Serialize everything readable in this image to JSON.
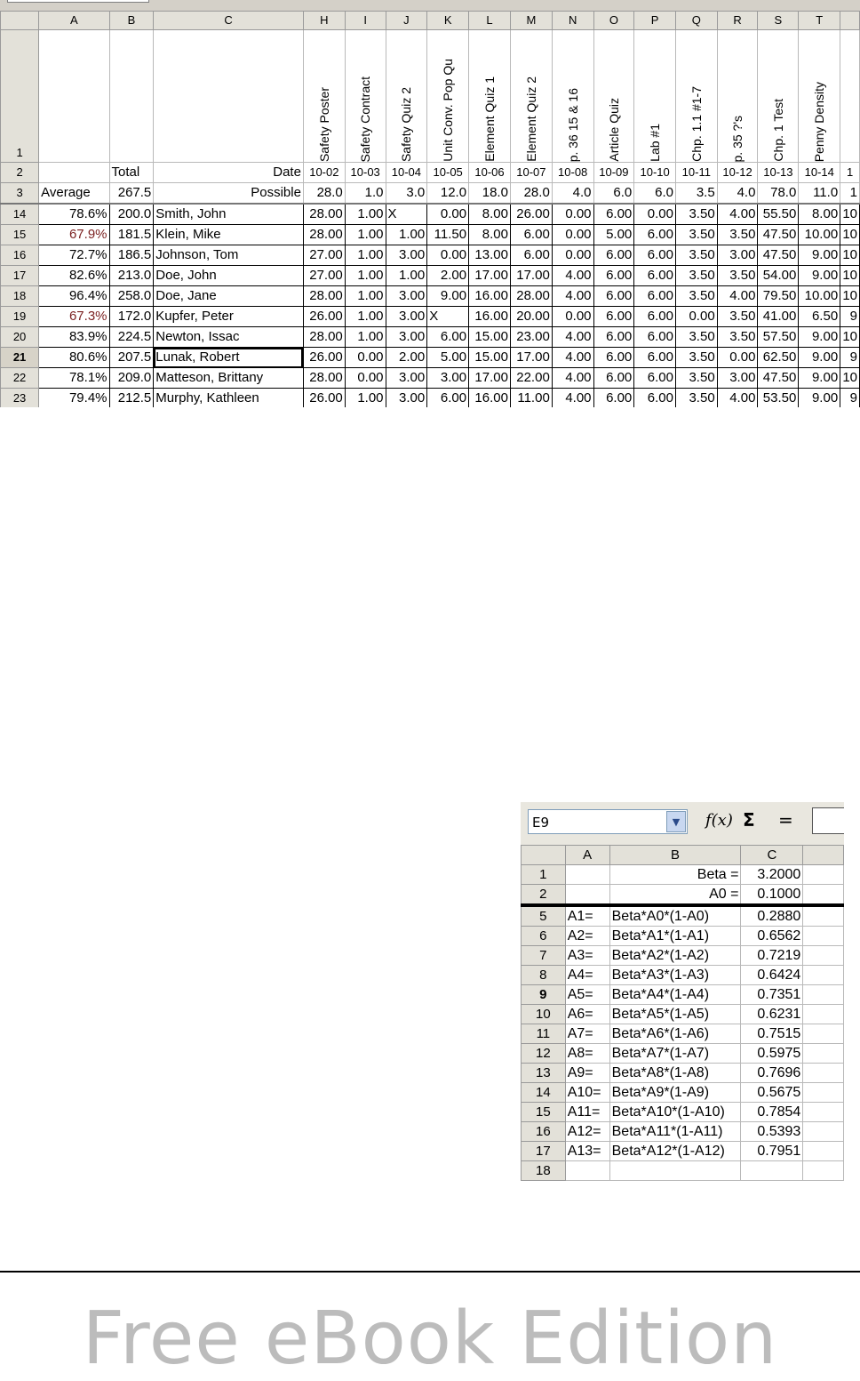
{
  "grades_sheet": {
    "columns": [
      "A",
      "B",
      "C",
      "H",
      "I",
      "J",
      "K",
      "L",
      "M",
      "N",
      "O",
      "P",
      "Q",
      "R",
      "S",
      "T",
      ""
    ],
    "assignments": [
      "Safety Poster",
      "Safety Contract",
      "Safety Quiz 2",
      "Unit Conv. Pop Qu",
      "Element Quiz 1",
      "Element Quiz 2",
      "p. 36 15 & 16",
      "Article Quiz",
      "Lab #1",
      "Chp. 1.1 #1-7",
      "p. 35 ?'s",
      "Chp. 1 Test",
      "Penny Density",
      ""
    ],
    "row2": {
      "num": "2",
      "a": "",
      "b": "Total",
      "c": "Date",
      "dates": [
        "10-02",
        "10-03",
        "10-04",
        "10-05",
        "10-06",
        "10-07",
        "10-08",
        "10-09",
        "10-10",
        "10-11",
        "10-12",
        "10-13",
        "10-14",
        "1"
      ]
    },
    "row3": {
      "num": "3",
      "a": "Average",
      "b": "267.5",
      "c": "Possible",
      "values": [
        "28.0",
        "1.0",
        "3.0",
        "12.0",
        "18.0",
        "28.0",
        "4.0",
        "6.0",
        "6.0",
        "3.5",
        "4.0",
        "78.0",
        "11.0",
        "1"
      ]
    },
    "row1_num": "1",
    "students": [
      {
        "row": "14",
        "pct": "78.6%",
        "total": "200.0",
        "name": "Smith, John",
        "scores": [
          "28.00",
          "1.00",
          "X",
          "0.00",
          "8.00",
          "26.00",
          "0.00",
          "6.00",
          "0.00",
          "3.50",
          "4.00",
          "55.50",
          "8.00",
          "10"
        ]
      },
      {
        "row": "15",
        "pct": "67.9%",
        "total": "181.5",
        "name": "Klein, Mike",
        "scores": [
          "28.00",
          "1.00",
          "1.00",
          "11.50",
          "8.00",
          "6.00",
          "0.00",
          "5.00",
          "6.00",
          "3.50",
          "3.50",
          "47.50",
          "10.00",
          "10"
        ]
      },
      {
        "row": "16",
        "pct": "72.7%",
        "total": "186.5",
        "name": "Johnson, Tom",
        "scores": [
          "27.00",
          "1.00",
          "3.00",
          "0.00",
          "13.00",
          "6.00",
          "0.00",
          "6.00",
          "6.00",
          "3.50",
          "3.00",
          "47.50",
          "9.00",
          "10"
        ]
      },
      {
        "row": "17",
        "pct": "82.6%",
        "total": "213.0",
        "name": "Doe, John",
        "scores": [
          "27.00",
          "1.00",
          "1.00",
          "2.00",
          "17.00",
          "17.00",
          "4.00",
          "6.00",
          "6.00",
          "3.50",
          "3.50",
          "54.00",
          "9.00",
          "10"
        ]
      },
      {
        "row": "18",
        "pct": "96.4%",
        "total": "258.0",
        "name": "Doe, Jane",
        "scores": [
          "28.00",
          "1.00",
          "3.00",
          "9.00",
          "16.00",
          "28.00",
          "4.00",
          "6.00",
          "6.00",
          "3.50",
          "4.00",
          "79.50",
          "10.00",
          "10"
        ]
      },
      {
        "row": "19",
        "pct": "67.3%",
        "total": "172.0",
        "name": "Kupfer, Peter",
        "scores": [
          "26.00",
          "1.00",
          "3.00",
          "X",
          "16.00",
          "20.00",
          "0.00",
          "6.00",
          "6.00",
          "0.00",
          "3.50",
          "41.00",
          "6.50",
          "9"
        ]
      },
      {
        "row": "20",
        "pct": "83.9%",
        "total": "224.5",
        "name": "Newton, Issac",
        "scores": [
          "28.00",
          "1.00",
          "3.00",
          "6.00",
          "15.00",
          "23.00",
          "4.00",
          "6.00",
          "6.00",
          "3.50",
          "3.50",
          "57.50",
          "9.00",
          "10"
        ]
      },
      {
        "row": "21",
        "pct": "80.6%",
        "total": "207.5",
        "name": "Lunak, Robert",
        "scores": [
          "26.00",
          "0.00",
          "2.00",
          "5.00",
          "15.00",
          "17.00",
          "4.00",
          "6.00",
          "6.00",
          "3.50",
          "0.00",
          "62.50",
          "9.00",
          "9"
        ]
      },
      {
        "row": "22",
        "pct": "78.1%",
        "total": "209.0",
        "name": "Matteson, Brittany",
        "scores": [
          "28.00",
          "0.00",
          "3.00",
          "3.00",
          "17.00",
          "22.00",
          "4.00",
          "6.00",
          "6.00",
          "3.50",
          "3.00",
          "47.50",
          "9.00",
          "10"
        ]
      },
      {
        "row": "23",
        "pct": "79.4%",
        "total": "212.5",
        "name": "Murphy, Kathleen",
        "scores": [
          "26.00",
          "1.00",
          "3.00",
          "6.00",
          "16.00",
          "11.00",
          "4.00",
          "6.00",
          "6.00",
          "3.50",
          "4.00",
          "53.50",
          "9.00",
          "9"
        ]
      }
    ],
    "low_color": "#7a1f1f"
  },
  "calc_sheet": {
    "name_box": "E9",
    "toolbar": {
      "fx": "f(x)",
      "sigma": "Σ",
      "equals": "="
    },
    "columns": [
      "A",
      "B",
      "C",
      ""
    ],
    "rows": [
      {
        "num": "1",
        "a": "",
        "b": "Beta =",
        "c": "3.2000"
      },
      {
        "num": "2",
        "a": "",
        "b": "A0 =",
        "c": "0.1000"
      },
      {
        "num": "5",
        "a": "A1=",
        "b": "Beta*A0*(1-A0)",
        "c": "0.2880"
      },
      {
        "num": "6",
        "a": "A2=",
        "b": "Beta*A1*(1-A1)",
        "c": "0.6562"
      },
      {
        "num": "7",
        "a": "A3=",
        "b": "Beta*A2*(1-A2)",
        "c": "0.7219"
      },
      {
        "num": "8",
        "a": "A4=",
        "b": "Beta*A3*(1-A3)",
        "c": "0.6424"
      },
      {
        "num": "9",
        "a": "A5=",
        "b": "Beta*A4*(1-A4)",
        "c": "0.7351"
      },
      {
        "num": "10",
        "a": "A6=",
        "b": "Beta*A5*(1-A5)",
        "c": "0.6231"
      },
      {
        "num": "11",
        "a": "A7=",
        "b": "Beta*A6*(1-A6)",
        "c": "0.7515"
      },
      {
        "num": "12",
        "a": "A8=",
        "b": "Beta*A7*(1-A7)",
        "c": "0.5975"
      },
      {
        "num": "13",
        "a": "A9=",
        "b": "Beta*A8*(1-A8)",
        "c": "0.7696"
      },
      {
        "num": "14",
        "a": "A10=",
        "b": "Beta*A9*(1-A9)",
        "c": "0.5675"
      },
      {
        "num": "15",
        "a": "A11=",
        "b": "Beta*A10*(1-A10)",
        "c": "0.7854"
      },
      {
        "num": "16",
        "a": "A12=",
        "b": "Beta*A11*(1-A11)",
        "c": "0.5393"
      },
      {
        "num": "17",
        "a": "A13=",
        "b": "Beta*A12*(1-A12)",
        "c": "0.7951"
      },
      {
        "num": "18",
        "a": "",
        "b": "",
        "c": ""
      }
    ]
  },
  "footer": {
    "watermark": "Free eBook Edition"
  }
}
